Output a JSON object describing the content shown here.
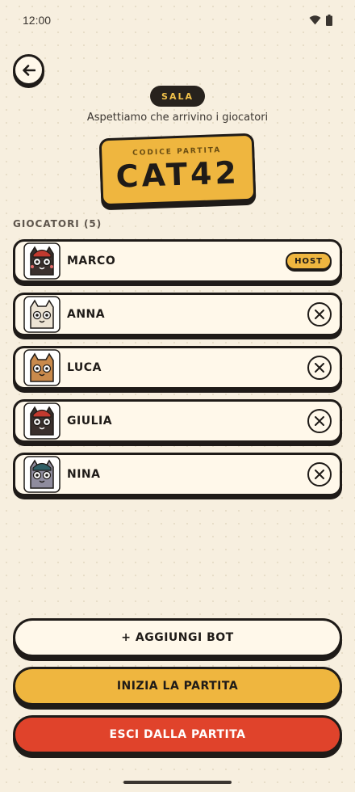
{
  "status_bar": {
    "time": "12:00",
    "wifi_icon": "wifi-icon",
    "battery_icon": "battery-icon"
  },
  "header": {
    "back_icon": "arrow-left-icon",
    "badge": "SALA",
    "subtitle": "Aspettiamo che arrivino i giocatori"
  },
  "game_code": {
    "label": "CODICE PARTITA",
    "value": "CAT42"
  },
  "players_heading": "GIOCATORI (5)",
  "players": [
    {
      "name": "MARCO",
      "role": "HOST",
      "fur": "#3a302d",
      "hat": "#c23a2f"
    },
    {
      "name": "ANNA",
      "role": "",
      "fur": "#ece3d4",
      "hat": ""
    },
    {
      "name": "LUCA",
      "role": "",
      "fur": "#c98a4c",
      "hat": ""
    },
    {
      "name": "GIULIA",
      "role": "",
      "fur": "#3a302d",
      "hat": "#c23a2f"
    },
    {
      "name": "NINA",
      "role": "",
      "fur": "#8f8c9e",
      "hat": "#2f5f66"
    }
  ],
  "actions": {
    "add_bot": "+ AGGIUNGI BOT",
    "start": "INIZIA LA PARTITA",
    "leave": "ESCI DALLA PARTITA"
  },
  "colors": {
    "background": "#f7efdf",
    "accent_yellow": "#efb63f",
    "danger_red": "#e0432b",
    "ink": "#1f1b18"
  }
}
